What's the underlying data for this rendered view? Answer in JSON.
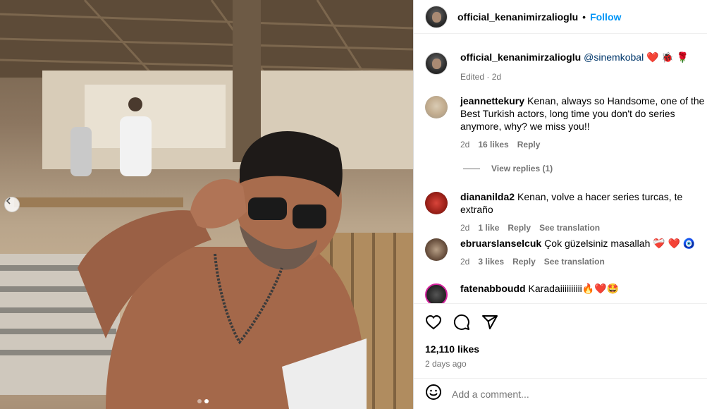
{
  "post": {
    "owner": "official_kenanimirzalioglu",
    "follow_label": "Follow",
    "separator": "•",
    "caption_mention": "@sinemkobal",
    "caption_emojis": "❤️ 🐞 🌹",
    "caption_meta": "Edited · 2d",
    "carousel_dots": 2,
    "carousel_active": 2
  },
  "comments": [
    {
      "user": "jeannettekury",
      "text": "Kenan, always so Handsome, one of the Best Turkish actors, long time you don't do series anymore, why? we miss you!!",
      "time": "2d",
      "likes": "16 likes",
      "reply": "Reply",
      "view_replies": "View replies (1)"
    },
    {
      "user": "diananilda2",
      "text": "Kenan, volve a hacer series turcas, te extraño",
      "time": "2d",
      "likes": "1 like",
      "reply": "Reply",
      "translate": "See translation"
    },
    {
      "user": "ebruarslanselcuk",
      "text": "Çok güzelsiniz masallah",
      "emojis": "❤️‍🩹 ❤️ 🧿",
      "time": "2d",
      "likes": "3 likes",
      "reply": "Reply",
      "translate": "See translation"
    },
    {
      "user": "fatenabboudd",
      "text": "Karadaiiiiiiiiii🔥❤️🤩"
    }
  ],
  "actions": {
    "likes": "12,110 likes",
    "time_ago": "2 days ago"
  },
  "add_comment": {
    "placeholder": "Add a comment..."
  },
  "icons": {
    "like": "heart-icon",
    "comment": "comment-icon",
    "share": "share-icon",
    "emoji": "emoji-icon",
    "prev": "chevron-left-icon"
  },
  "colors": {
    "link": "#0095f6",
    "mention": "#00376b",
    "muted": "#737373"
  }
}
